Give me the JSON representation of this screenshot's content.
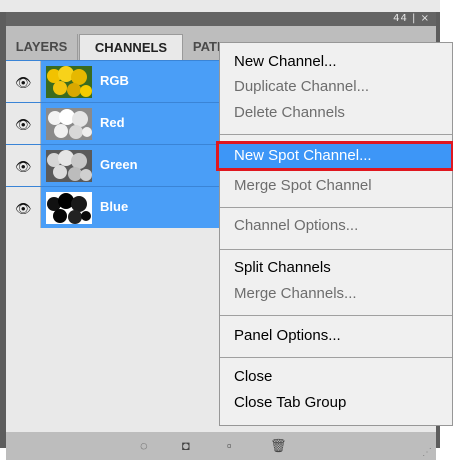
{
  "window": {
    "buttons": "44 | ×"
  },
  "tabs": [
    {
      "label": "LAYERS"
    },
    {
      "label": "CHANNELS"
    },
    {
      "label": "PATHS"
    }
  ],
  "panel_menu_button": {
    "icon": "panel-menu-icon",
    "glyph": "▾≡"
  },
  "channels": [
    {
      "name": "RGB",
      "thumbnail": "yellow-flowers-color"
    },
    {
      "name": "Red",
      "thumbnail": "flowers-grayscale-light"
    },
    {
      "name": "Green",
      "thumbnail": "flowers-grayscale-mid"
    },
    {
      "name": "Blue",
      "thumbnail": "flowers-grayscale-dark"
    }
  ],
  "menu": {
    "items": [
      {
        "label": "New Channel...",
        "enabled": true
      },
      {
        "label": "Duplicate Channel...",
        "enabled": false
      },
      {
        "label": "Delete Channels",
        "enabled": false
      },
      {
        "label": "New Spot Channel...",
        "enabled": true,
        "highlighted": true
      },
      {
        "label": "Merge Spot Channel",
        "enabled": false
      },
      {
        "label": "Channel Options...",
        "enabled": false
      },
      {
        "label": "Split Channels",
        "enabled": true
      },
      {
        "label": "Merge Channels...",
        "enabled": false
      },
      {
        "label": "Panel Options...",
        "enabled": true
      },
      {
        "label": "Close",
        "enabled": true
      },
      {
        "label": "Close Tab Group",
        "enabled": true
      }
    ]
  },
  "bottom_bar": {
    "icons": [
      "load-selection-icon",
      "save-selection-icon",
      "new-channel-icon",
      "trash-icon"
    ]
  },
  "colors": {
    "selection_blue": "#4a9ef7",
    "highlight_red": "#e0171f",
    "menu_highlight": "#3d96f7"
  }
}
